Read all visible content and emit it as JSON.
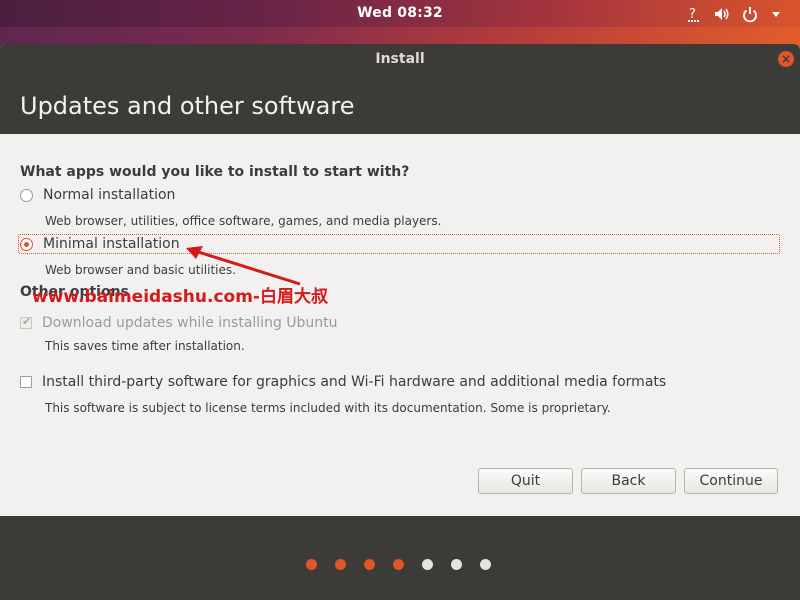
{
  "topbar": {
    "clock": "Wed 08:32",
    "icons": [
      "help-network-icon",
      "volume-icon",
      "power-icon",
      "chevron-down-icon"
    ]
  },
  "window": {
    "title": "Install",
    "header": "Updates and other software"
  },
  "question": "What apps would you like to install to start with?",
  "options": [
    {
      "label": "Normal installation",
      "description": "Web browser, utilities, office software, games, and media players.",
      "selected": false
    },
    {
      "label": "Minimal installation",
      "description": "Web browser and basic utilities.",
      "selected": true
    }
  ],
  "other": {
    "heading": "Other options",
    "items": [
      {
        "label": "Download updates while installing Ubuntu",
        "description": "This saves time after installation.",
        "checked": true,
        "enabled": false
      },
      {
        "label": "Install third-party software for graphics and Wi-Fi hardware and additional media formats",
        "description": "This software is subject to license terms included with its documentation. Some is proprietary.",
        "checked": false,
        "enabled": true
      }
    ]
  },
  "watermark": "www.baimeidashu.com-白眉大叔",
  "buttons": {
    "quit": "Quit",
    "back": "Back",
    "continue": "Continue"
  },
  "progress": {
    "total_steps": 7,
    "completed_steps": 4
  },
  "colors": {
    "accent": "#e0552a",
    "dark": "#3c3b37",
    "annotation": "#d41a1a"
  }
}
